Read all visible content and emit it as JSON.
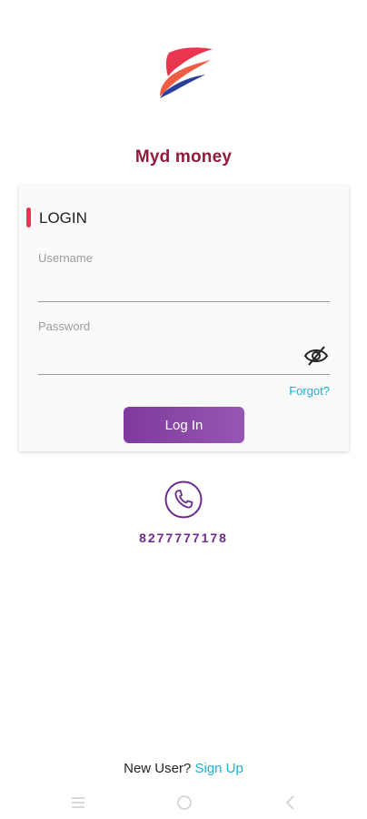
{
  "brand": {
    "name": "Myd money",
    "logo_icon": "wing-logo-icon",
    "colors": {
      "primary": "#8e1c3a",
      "logo_red": "#e9354d",
      "logo_blue": "#2b3f9a"
    }
  },
  "login_card": {
    "title": "LOGIN",
    "accent_color": "#e9354d",
    "username": {
      "label": "Username",
      "value": "",
      "placeholder": ""
    },
    "password": {
      "label": "Password",
      "value": "",
      "placeholder": "",
      "toggle_icon": "eye-off-icon"
    },
    "forgot_label": "Forgot?",
    "login_button_label": "Log In",
    "button_color": "#8a47a9",
    "link_color": "#1ab0d6"
  },
  "contact": {
    "icon": "phone-icon",
    "phone_number": "8277777178",
    "color": "#6e2a8f"
  },
  "footer": {
    "prompt": "New User?",
    "signup_label": "Sign Up"
  },
  "system_nav": {
    "items": [
      "menu-icon",
      "home-circle-icon",
      "back-chevron-icon"
    ]
  }
}
